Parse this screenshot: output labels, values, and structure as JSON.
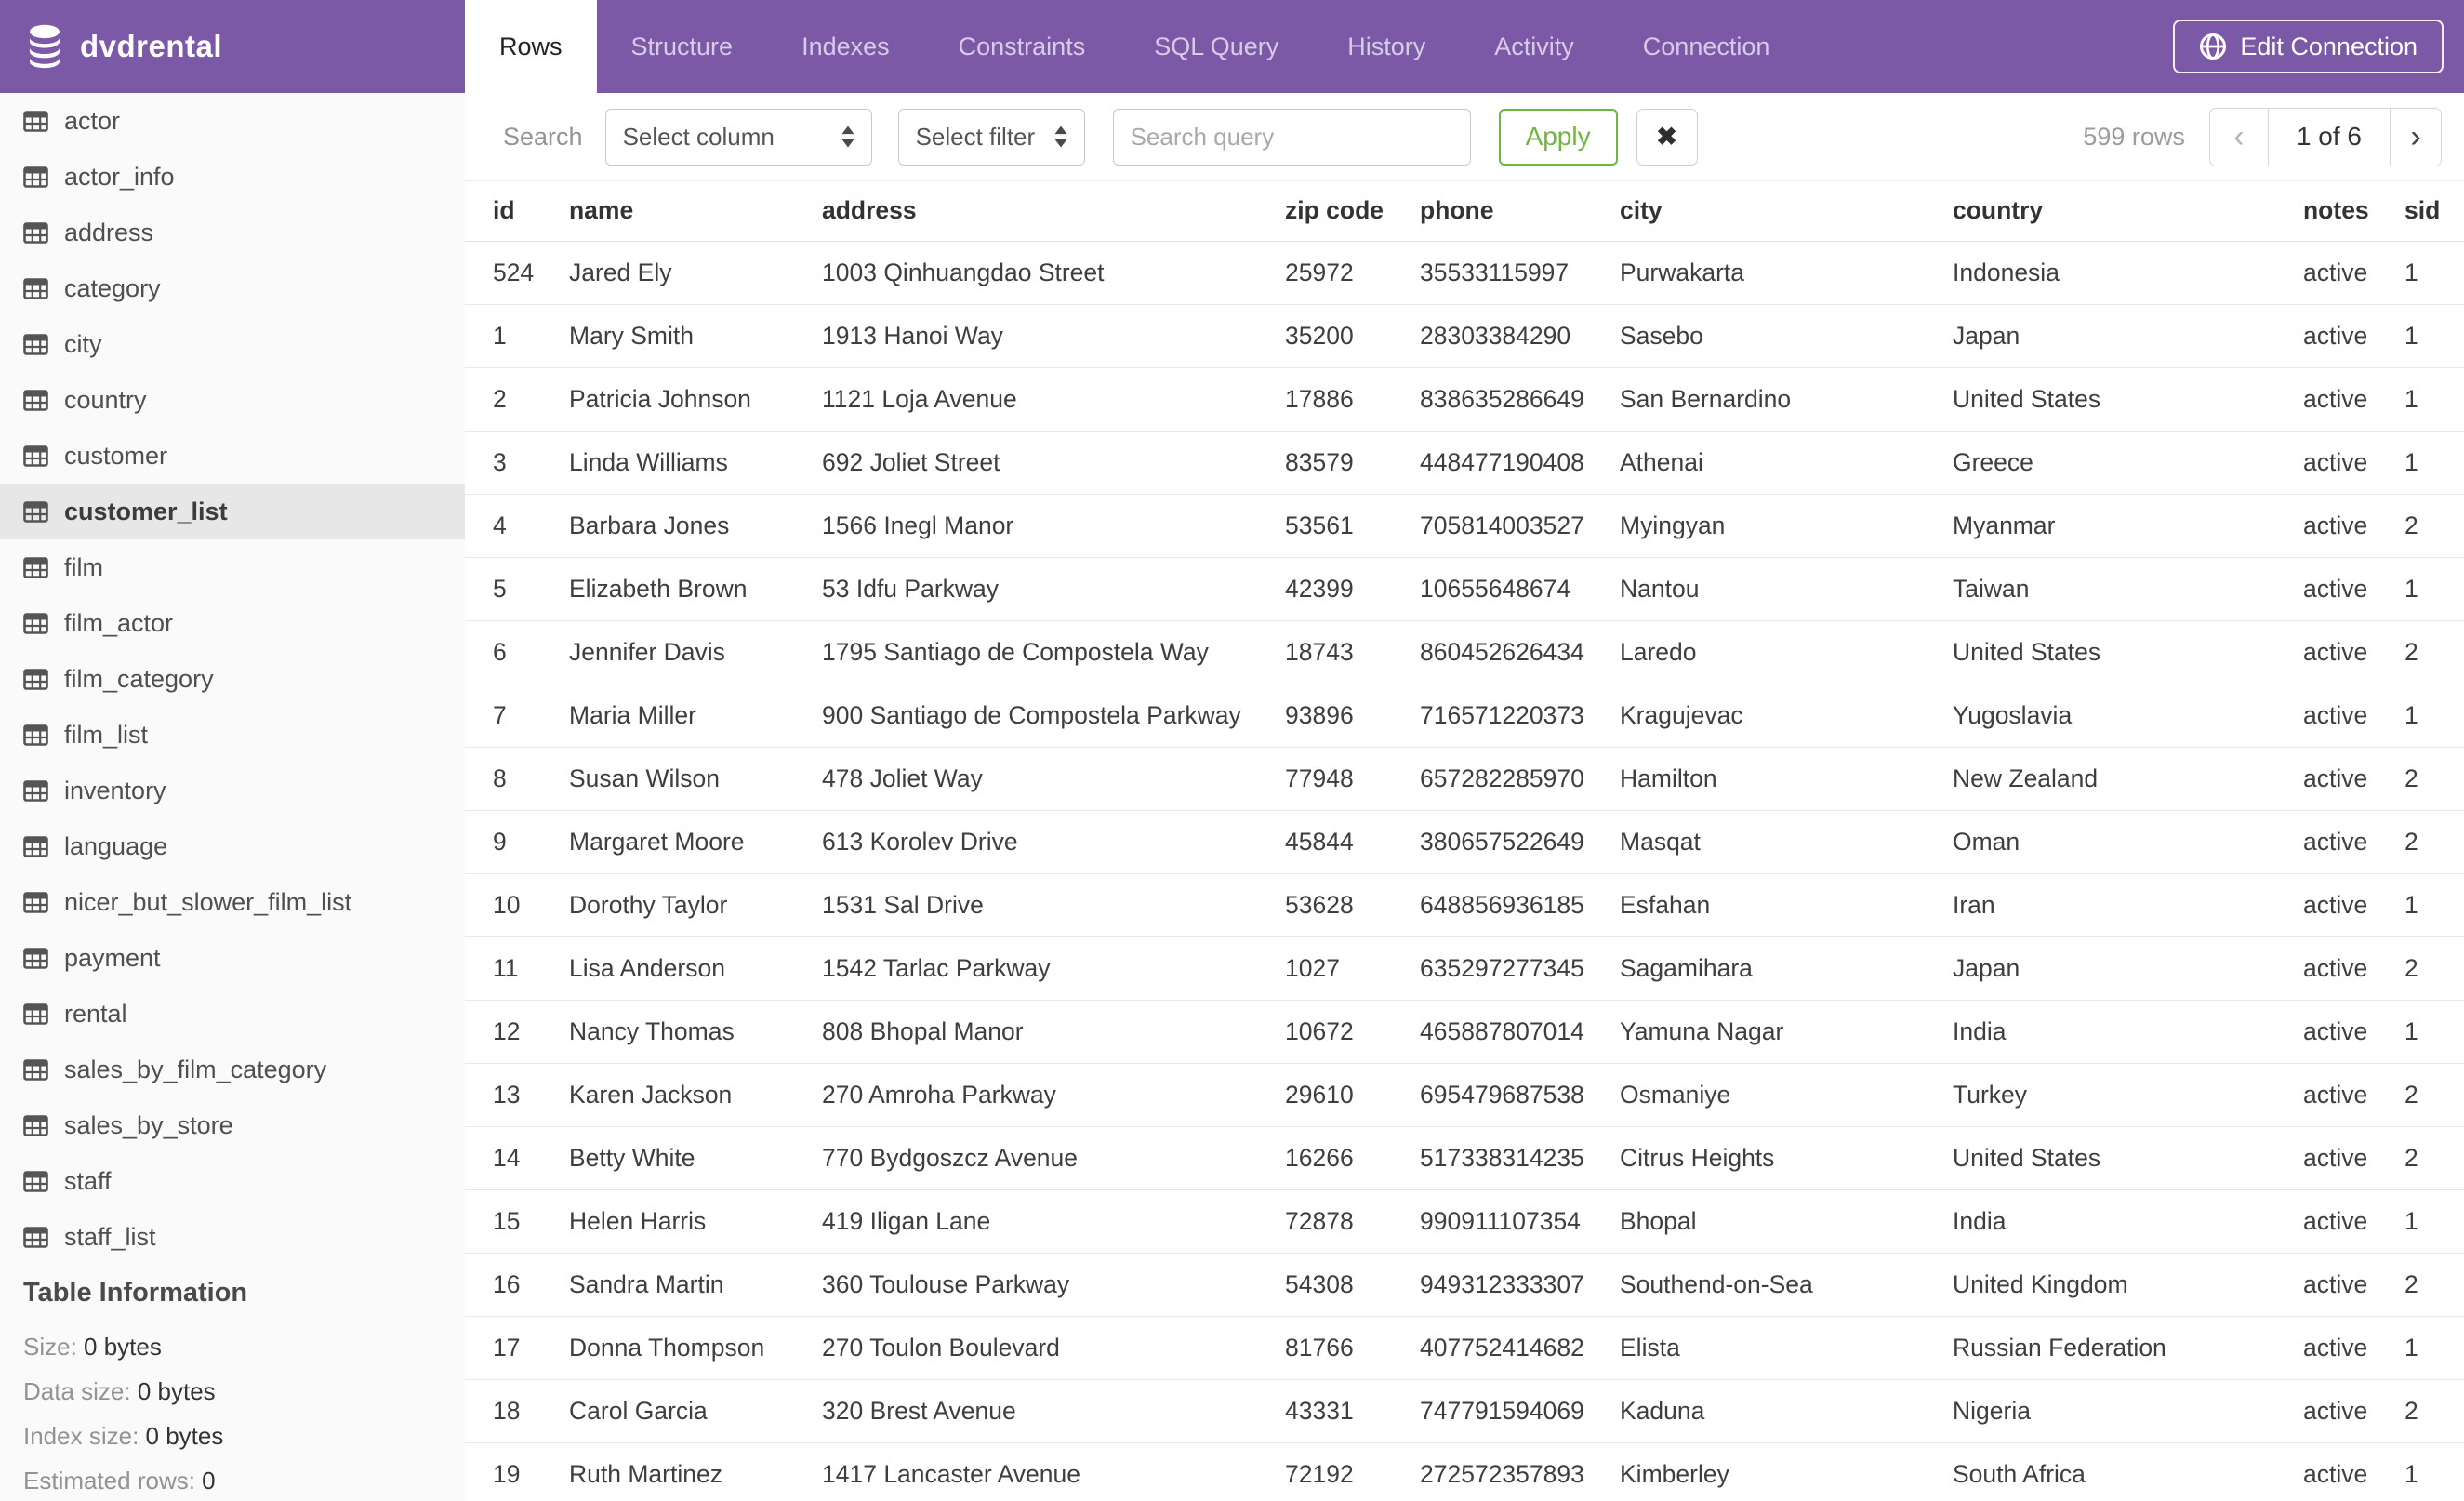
{
  "header": {
    "db_name": "dvdrental",
    "tabs": [
      "Rows",
      "Structure",
      "Indexes",
      "Constraints",
      "SQL Query",
      "History",
      "Activity",
      "Connection"
    ],
    "active_tab": "Rows",
    "edit_connection_label": "Edit Connection"
  },
  "sidebar": {
    "tables": [
      "actor",
      "actor_info",
      "address",
      "category",
      "city",
      "country",
      "customer",
      "customer_list",
      "film",
      "film_actor",
      "film_category",
      "film_list",
      "inventory",
      "language",
      "nicer_but_slower_film_list",
      "payment",
      "rental",
      "sales_by_film_category",
      "sales_by_store",
      "staff",
      "staff_list"
    ],
    "selected": "customer_list",
    "table_information": {
      "title": "Table Information",
      "fields": [
        {
          "label": "Size:",
          "value": "0 bytes"
        },
        {
          "label": "Data size:",
          "value": "0 bytes"
        },
        {
          "label": "Index size:",
          "value": "0 bytes"
        },
        {
          "label": "Estimated rows:",
          "value": "0"
        }
      ]
    }
  },
  "toolbar": {
    "search_label": "Search",
    "select_column": "Select column",
    "select_filter": "Select filter",
    "query_placeholder": "Search query",
    "apply_label": "Apply",
    "clear_icon": "✖",
    "rows_count": "599 rows",
    "pagination": {
      "prev_icon": "‹",
      "current": "1 of 6",
      "next_icon": "›"
    }
  },
  "table": {
    "columns": [
      "id",
      "name",
      "address",
      "zip code",
      "phone",
      "city",
      "country",
      "notes",
      "sid"
    ],
    "rows": [
      [
        "524",
        "Jared Ely",
        "1003 Qinhuangdao Street",
        "25972",
        "35533115997",
        "Purwakarta",
        "Indonesia",
        "active",
        "1"
      ],
      [
        "1",
        "Mary Smith",
        "1913 Hanoi Way",
        "35200",
        "28303384290",
        "Sasebo",
        "Japan",
        "active",
        "1"
      ],
      [
        "2",
        "Patricia Johnson",
        "1121 Loja Avenue",
        "17886",
        "838635286649",
        "San Bernardino",
        "United States",
        "active",
        "1"
      ],
      [
        "3",
        "Linda Williams",
        "692 Joliet Street",
        "83579",
        "448477190408",
        "Athenai",
        "Greece",
        "active",
        "1"
      ],
      [
        "4",
        "Barbara Jones",
        "1566 Inegl Manor",
        "53561",
        "705814003527",
        "Myingyan",
        "Myanmar",
        "active",
        "2"
      ],
      [
        "5",
        "Elizabeth Brown",
        "53 Idfu Parkway",
        "42399",
        "10655648674",
        "Nantou",
        "Taiwan",
        "active",
        "1"
      ],
      [
        "6",
        "Jennifer Davis",
        "1795 Santiago de Compostela Way",
        "18743",
        "860452626434",
        "Laredo",
        "United States",
        "active",
        "2"
      ],
      [
        "7",
        "Maria Miller",
        "900 Santiago de Compostela Parkway",
        "93896",
        "716571220373",
        "Kragujevac",
        "Yugoslavia",
        "active",
        "1"
      ],
      [
        "8",
        "Susan Wilson",
        "478 Joliet Way",
        "77948",
        "657282285970",
        "Hamilton",
        "New Zealand",
        "active",
        "2"
      ],
      [
        "9",
        "Margaret Moore",
        "613 Korolev Drive",
        "45844",
        "380657522649",
        "Masqat",
        "Oman",
        "active",
        "2"
      ],
      [
        "10",
        "Dorothy Taylor",
        "1531 Sal Drive",
        "53628",
        "648856936185",
        "Esfahan",
        "Iran",
        "active",
        "1"
      ],
      [
        "11",
        "Lisa Anderson",
        "1542 Tarlac Parkway",
        "1027",
        "635297277345",
        "Sagamihara",
        "Japan",
        "active",
        "2"
      ],
      [
        "12",
        "Nancy Thomas",
        "808 Bhopal Manor",
        "10672",
        "465887807014",
        "Yamuna Nagar",
        "India",
        "active",
        "1"
      ],
      [
        "13",
        "Karen Jackson",
        "270 Amroha Parkway",
        "29610",
        "695479687538",
        "Osmaniye",
        "Turkey",
        "active",
        "2"
      ],
      [
        "14",
        "Betty White",
        "770 Bydgoszcz Avenue",
        "16266",
        "517338314235",
        "Citrus Heights",
        "United States",
        "active",
        "2"
      ],
      [
        "15",
        "Helen Harris",
        "419 Iligan Lane",
        "72878",
        "990911107354",
        "Bhopal",
        "India",
        "active",
        "1"
      ],
      [
        "16",
        "Sandra Martin",
        "360 Toulouse Parkway",
        "54308",
        "949312333307",
        "Southend-on-Sea",
        "United Kingdom",
        "active",
        "2"
      ],
      [
        "17",
        "Donna Thompson",
        "270 Toulon Boulevard",
        "81766",
        "407752414682",
        "Elista",
        "Russian Federation",
        "active",
        "1"
      ],
      [
        "18",
        "Carol Garcia",
        "320 Brest Avenue",
        "43331",
        "747791594069",
        "Kaduna",
        "Nigeria",
        "active",
        "2"
      ],
      [
        "19",
        "Ruth Martinez",
        "1417 Lancaster Avenue",
        "72192",
        "272572357893",
        "Kimberley",
        "South Africa",
        "active",
        "1"
      ]
    ]
  },
  "colors": {
    "header_purple": "#7c59a6",
    "inactive_tab_text": "#d7cbe8",
    "apply_green": "#6fb53f",
    "selected_row_gray": "#e7e7e7",
    "sidebar_bg": "#fafafa"
  }
}
